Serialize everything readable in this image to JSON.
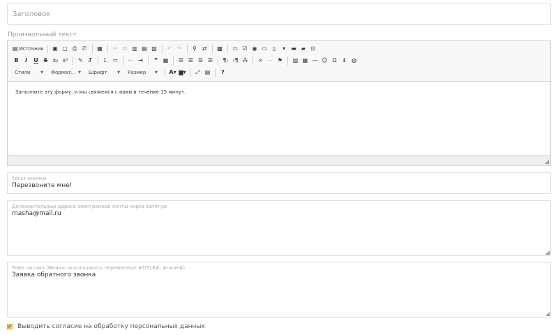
{
  "title_field": {
    "placeholder": "Заголовок"
  },
  "custom_text_label": "Произвольный текст",
  "editor": {
    "source_label": "Источник",
    "combos": {
      "styles": "Стили",
      "format": "Формат...",
      "font": "Шрифт",
      "size": "Размер"
    },
    "content": "Заполните эту форму, и мы свяжемся с вами в течение 15 минут."
  },
  "button_text": {
    "label": "Текст кнопки",
    "value": "Перезвоните мне!"
  },
  "emails": {
    "label": "Дополнительные адреса электронной почты через запятую",
    "value": "masha@mail.ru"
  },
  "subject": {
    "label": "Тема письма (Можно использовать переменные #TITLE#, #поле#)",
    "value": "Заявка обратного звонка"
  },
  "consent": {
    "label": "Выводить согласие на обработку персональных данных",
    "checked": true
  },
  "icons": {
    "checkbox_check": "✔",
    "resize": "◢"
  }
}
